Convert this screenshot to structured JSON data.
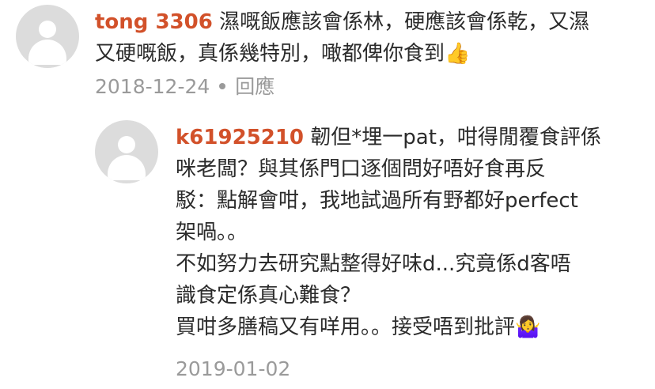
{
  "comment1": {
    "username": "tong 3306",
    "line1": "濕嘅飯應該會係林，硬應該會係乾，又濕",
    "line2": "又硬嘅飯，真係幾特別，噉都俾你食到",
    "emoji": "👍",
    "date": "2018-12-24",
    "reply_label": "回應"
  },
  "comment2": {
    "username": "k61925210",
    "line1": "韌但*埋一pat，咁得閒覆食評係",
    "lines": [
      "咪老闆？與其係門口逐個問好唔好食再反",
      "駁：點解會咁，我地試過所有野都好perfect",
      "架喎。。",
      "不如努力去研究點整得好味d...究竟係d客唔",
      "識食定係真心難食？",
      "買咁多膳稿又有咩用。。接受唔到批評"
    ],
    "emoji": "🤷‍♀️",
    "date": "2019-01-02"
  }
}
